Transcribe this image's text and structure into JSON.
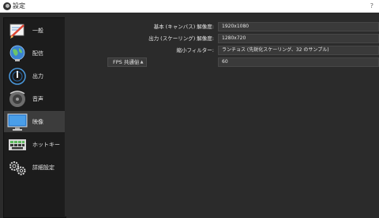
{
  "window": {
    "title": "設定",
    "help": "?"
  },
  "sidebar": {
    "items": [
      {
        "label": "一般",
        "icon": "general-icon"
      },
      {
        "label": "配信",
        "icon": "stream-globe-icon"
      },
      {
        "label": "出力",
        "icon": "output-icon"
      },
      {
        "label": "音声",
        "icon": "audio-speaker-icon"
      },
      {
        "label": "映像",
        "icon": "video-monitor-icon",
        "active": true
      },
      {
        "label": "ホットキー",
        "icon": "hotkeys-keyboard-icon"
      },
      {
        "label": "詳細設定",
        "icon": "advanced-gears-icon"
      }
    ]
  },
  "video": {
    "base_resolution": {
      "label": "基本 (キャンバス) 解像度:",
      "value": "1920x1080"
    },
    "output_resolution": {
      "label": "出力 (スケーリング) 解像度:",
      "value": "1280x720"
    },
    "downscale_filter": {
      "label": "縮小フィルター:",
      "value": "ランチョス (先鋭化スケーリング、32 のサンプル)"
    },
    "fps": {
      "type": "FPS 共通値",
      "value": "60"
    }
  },
  "colors": {
    "accent_active": "#3c3c3c",
    "background": "#2b2b2b",
    "sidebar": "#1c1c1c"
  }
}
